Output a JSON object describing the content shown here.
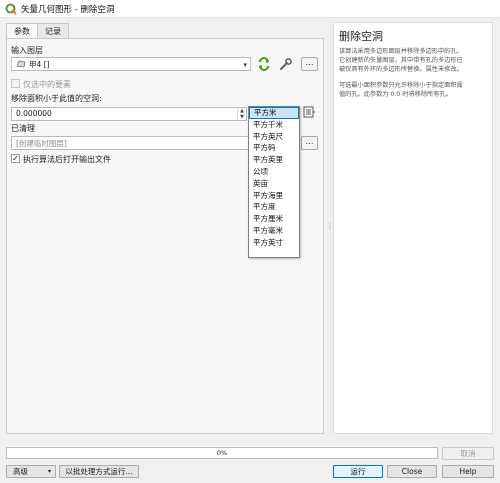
{
  "window": {
    "title": "矢量几何图形 - 删除空洞",
    "icon": "qgis-logo-icon"
  },
  "tabs": [
    {
      "label": "参数",
      "active": true
    },
    {
      "label": "记录",
      "active": false
    }
  ],
  "params": {
    "input_layer_label": "输入图层",
    "input_layer_value": "甲4 []",
    "selected_only_label": "仅选中的要素",
    "min_area_label": "移除面积小于此值的空洞:",
    "min_area_value": "0.000000",
    "output_label": "已清理",
    "output_placeholder": "[创建临时图层]",
    "open_output_label": "执行算法后打开输出文件",
    "more_button_label": "…"
  },
  "unit_options": [
    {
      "label": "平方米",
      "selected": true
    },
    {
      "label": "平方千米",
      "selected": false
    },
    {
      "label": "平方英尺",
      "selected": false
    },
    {
      "label": "平方码",
      "selected": false
    },
    {
      "label": "平方英里",
      "selected": false
    },
    {
      "label": "公顷",
      "selected": false
    },
    {
      "label": "英亩",
      "selected": false
    },
    {
      "label": "平方海里",
      "selected": false
    },
    {
      "label": "平方度",
      "selected": false
    },
    {
      "label": "平方厘米",
      "selected": false
    },
    {
      "label": "平方毫米",
      "selected": false
    },
    {
      "label": "平方英寸",
      "selected": false
    }
  ],
  "help": {
    "title": "删除空洞",
    "para1_line1": "该算法采用多边形图层并移除多边形中的孔。",
    "para1_line2": "它创建新的矢量图层，其中带有孔的多边形已",
    "para1_line3": "被仅具有外环的多边形所替换。属性未修改。",
    "para2_line1": "可选最小面积参数只允许移除小于指定面积阈",
    "para2_line2": "值的孔。此参数为 0.0 时将移除所有孔。"
  },
  "progress": {
    "text": "0%",
    "value": 0
  },
  "footer": {
    "cancel_label": "取消",
    "advanced_label": "高级",
    "batch_label": "以批处理方式运行...",
    "run_label": "运行",
    "close_label": "Close",
    "help_label": "Help"
  },
  "colors": {
    "accent": "#0078d7",
    "selected_bg": "#cce4f7",
    "qgis_green": "#589632"
  }
}
